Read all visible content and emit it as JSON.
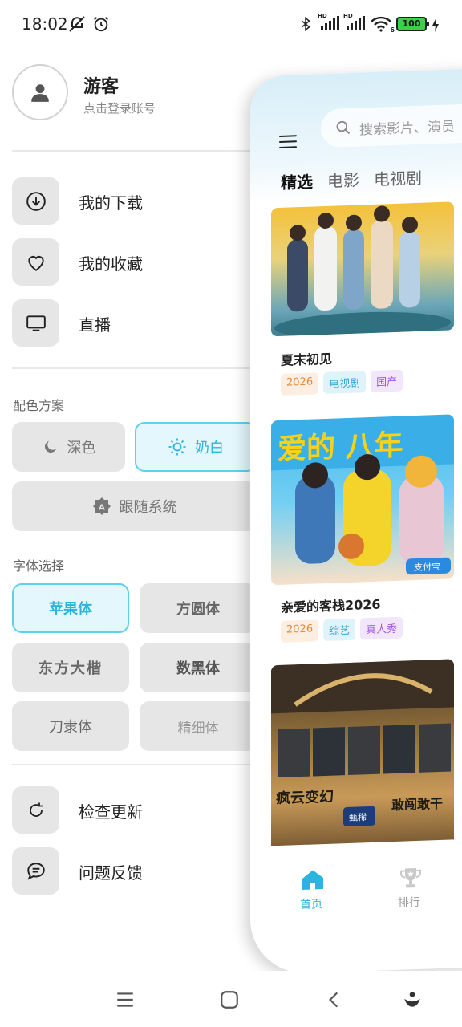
{
  "status_bar": {
    "time": "18:02",
    "signal_label_1": "HD",
    "signal_label_2": "HD",
    "wifi_label": "6",
    "battery": "100"
  },
  "profile": {
    "name": "游客",
    "subtitle": "点击登录账号"
  },
  "menu": {
    "downloads": "我的下载",
    "favorites": "我的收藏",
    "live": "直播",
    "check_update": "检查更新",
    "feedback": "问题反馈"
  },
  "theme": {
    "section_label": "配色方案",
    "dark": "深色",
    "cream": "奶白",
    "follow_system": "跟随系统",
    "selected": "奶白"
  },
  "font": {
    "section_label": "字体选择",
    "options": [
      "苹果体",
      "方圆体",
      "东方大楷",
      "数黑体",
      "刀隶体",
      "精细体"
    ],
    "selected": "苹果体"
  },
  "preview": {
    "search_placeholder": "搜索影片、演员",
    "tabs": [
      "精选",
      "电影",
      "电视剧"
    ],
    "active_tab": "精选",
    "cards": [
      {
        "title": "夏末初见",
        "tags": [
          "2026",
          "电视剧",
          "国产"
        ]
      },
      {
        "title": "亲爱的客栈2026",
        "tags": [
          "2026",
          "综艺",
          "真人秀"
        ]
      },
      {
        "title": "",
        "tags": []
      }
    ],
    "poster_text": {
      "card2_banner": "爱的 八年",
      "card2_badge": "支付宝",
      "card3_left": "疯云变幻",
      "card3_right": "敢闯敢干",
      "card3_logo": "甄稀"
    },
    "nav_home": "首页",
    "nav_rank": "排行"
  },
  "colors": {
    "accent": "#2bb5de",
    "accent_border": "#5fd0ee",
    "chip_bg": "#e6e6e6"
  }
}
